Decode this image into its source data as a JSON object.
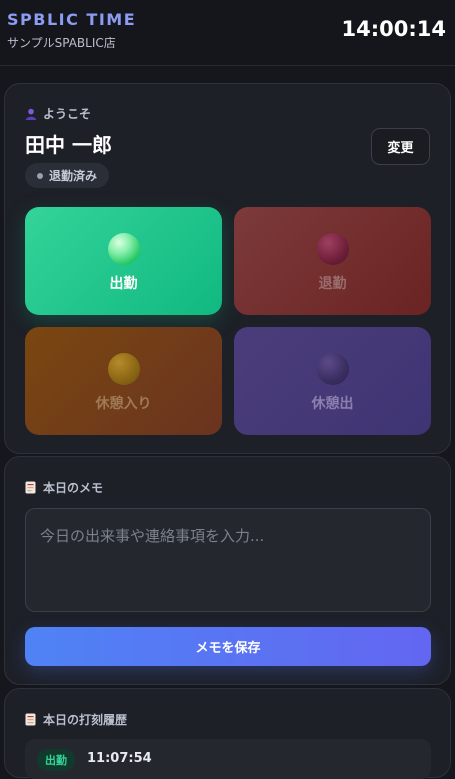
{
  "header": {
    "brand": "SPBLIC TIME",
    "store": "サンプルSPABLIC店",
    "clock": "14:00:14"
  },
  "welcome_card": {
    "greeting": "ようこそ",
    "username": "田中 一郎",
    "status": "退勤済み",
    "change_label": "変更"
  },
  "punch_buttons": {
    "clock_in": "出勤",
    "clock_out": "退勤",
    "break_start": "休憩入り",
    "break_end": "休憩出"
  },
  "memo_card": {
    "title": "本日のメモ",
    "placeholder": "今日の出来事や連絡事項を入力...",
    "save_label": "メモを保存"
  },
  "history_card": {
    "title": "本日の打刻履歴",
    "entries": [
      {
        "type": "出勤",
        "time": "11:07:54"
      }
    ]
  },
  "colors": {
    "accent": "#6366f1",
    "clock_in": "#10b981",
    "clock_out": "#6b2323",
    "break_start": "#7a4710",
    "break_end": "#4b3d7a"
  }
}
